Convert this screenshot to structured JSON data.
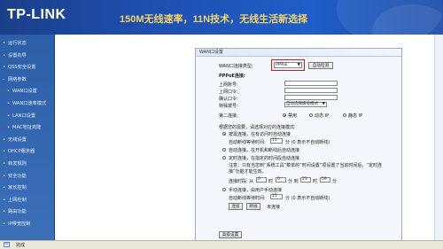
{
  "banner": {
    "logo": "TP-LINK",
    "slogan": "150M无线速率，11N技术，无线生活新选择"
  },
  "sidebar": {
    "items": [
      {
        "label": "运行状态",
        "sub": false
      },
      {
        "label": "设置向导",
        "sub": false
      },
      {
        "label": "QSS安全设置",
        "sub": false
      },
      {
        "label": "网络参数",
        "sub": false,
        "prefix": "-"
      },
      {
        "label": "WAN口设置",
        "sub": true
      },
      {
        "label": "WAN口速率模式",
        "sub": true
      },
      {
        "label": "LAN口设置",
        "sub": true
      },
      {
        "label": "MAC地址克隆",
        "sub": true
      },
      {
        "label": "无线设置",
        "sub": false
      },
      {
        "label": "DHCP服务器",
        "sub": false
      },
      {
        "label": "转发规则",
        "sub": false
      },
      {
        "label": "安全功能",
        "sub": false
      },
      {
        "label": "家长控制",
        "sub": false
      },
      {
        "label": "上网控制",
        "sub": false
      },
      {
        "label": "路由功能",
        "sub": false
      },
      {
        "label": "IP带宽控制",
        "sub": false
      }
    ]
  },
  "panel": {
    "title": "WAN口设置",
    "wan_type_label": "WAN口连接类型:",
    "wan_type_value": "PPPoE",
    "auto_detect": "自动检测",
    "pppoe_header": "PPPoE连接:",
    "username_label": "上网账号:",
    "password_label": "上网口令:",
    "confirm_label": "确认口令:",
    "special_label": "特殊拨号:",
    "special_value": "自动选择拨号模式",
    "second_label": "第二连接:",
    "second_opts": [
      "禁用",
      "动态 IP",
      "静态 IP"
    ],
    "mode_hint": "根据您的需要，请选择对应的连接模式:",
    "modes": [
      "按需连接，在有访问时自动连接",
      "自动连接，在开机和断线后自动连接",
      "定时连接，在指定的时间段自动连接"
    ],
    "idle_label_1": "自动断线等待时间:",
    "idle_value_1": "15",
    "idle_unit_1": "分 (0 表示不自动断线)",
    "note": "注意：只有当您到“系统工具”菜单的“时间设置”项设置了当前时间后，“定时连接”功能才能生效。",
    "period_label": "连接时段: 从",
    "period_from_h": "0",
    "period_from_m": "0",
    "period_to_h": "23",
    "period_to_m": "59",
    "unit_hour": "时",
    "unit_min_to": "分 到",
    "unit_min": "分",
    "manual_mode": "手动连接，由用户手动连接",
    "idle_label_2": "自动断线等待时间:",
    "idle_value_2": "15",
    "idle_unit_2": "分 (0 表示不自动断线)",
    "connect_btn": "连接",
    "disconnect_btn": "断线",
    "connected_text": "未连接",
    "advanced_btn": "高级设置"
  },
  "status": {
    "text": "完成"
  },
  "colors": {
    "banner": "#1f4fb0",
    "slogan": "#f3d36b",
    "sidebar": "#2c5fa8",
    "highlight": "#d01818"
  }
}
